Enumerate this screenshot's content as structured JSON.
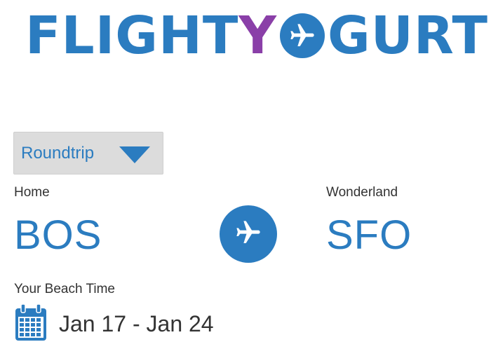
{
  "logo": {
    "part1": "FLIGHT",
    "part2": "Y",
    "part3": "GURT",
    "plane_icon": "airplane-icon"
  },
  "colors": {
    "brand_blue": "#2b7cc0",
    "brand_purple": "#8a3fa8",
    "select_bg": "#dcdcdc",
    "text": "#333333"
  },
  "trip_type": {
    "selected": "Roundtrip",
    "icon": "triangle-down-icon"
  },
  "origin": {
    "label": "Home",
    "code": "BOS"
  },
  "destination": {
    "label": "Wonderland",
    "code": "SFO"
  },
  "swap": {
    "icon": "airplane-icon"
  },
  "dates": {
    "label": "Your Beach Time",
    "value": "Jan 17 - Jan 24",
    "icon": "calendar-icon"
  }
}
